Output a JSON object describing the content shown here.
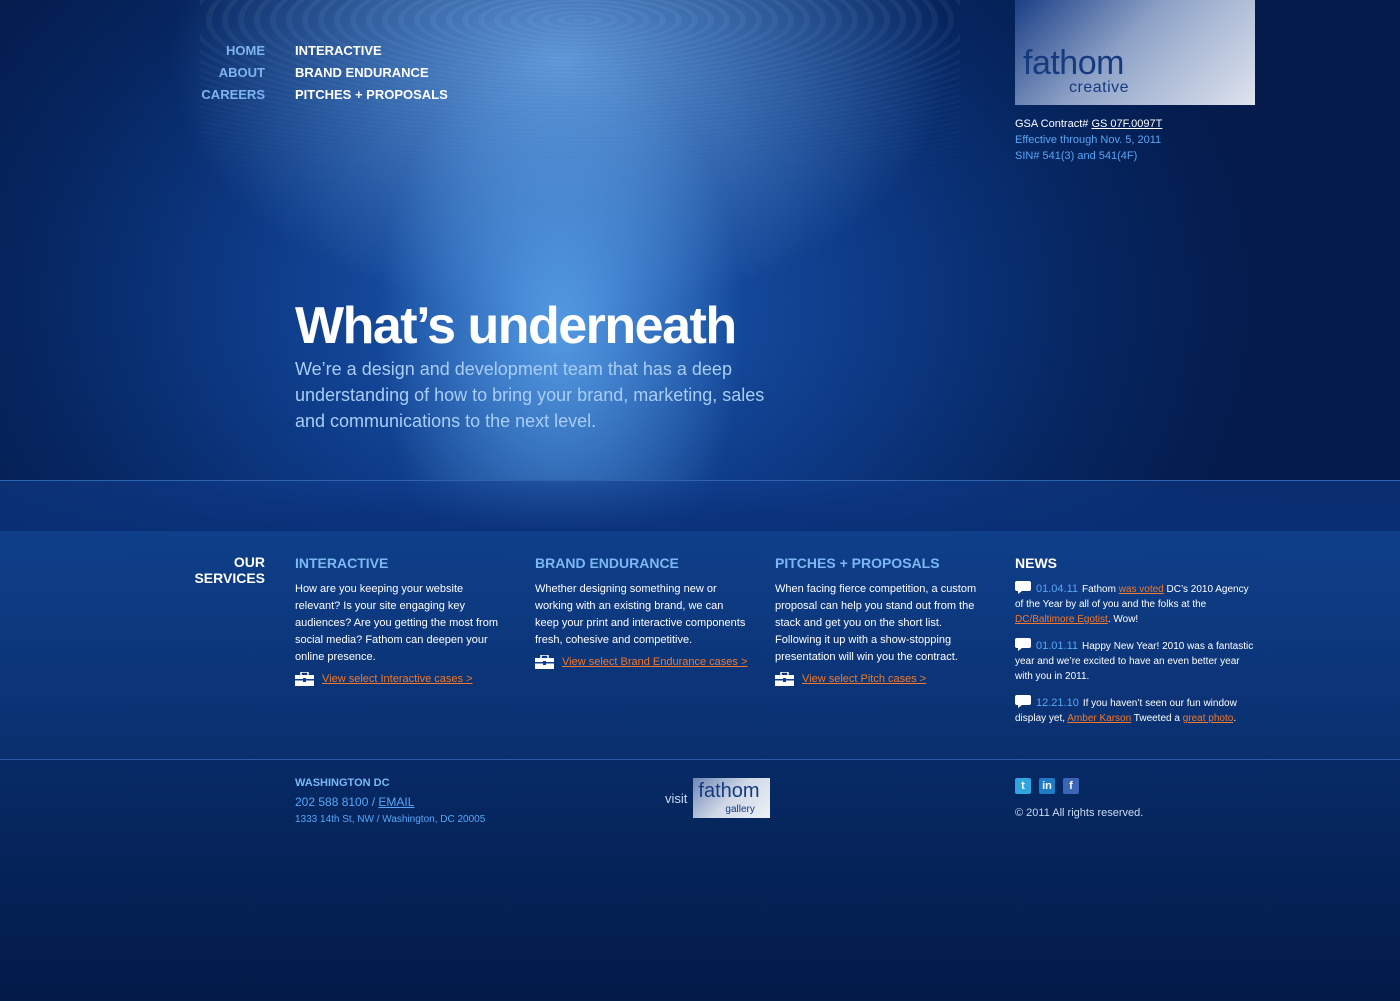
{
  "nav": {
    "left": [
      "HOME",
      "ABOUT",
      "CAREERS"
    ],
    "right": [
      "INTERACTIVE",
      "BRAND ENDURANCE",
      "PITCHES + PROPOSALS"
    ]
  },
  "logo": {
    "word": "fathom",
    "sub": "creative"
  },
  "gsa": {
    "label": "GSA Contract#",
    "number": "GS 07F.0097T",
    "effective": "Effective through Nov. 5, 2011",
    "sin": "SIN# 541(3) and 541(4F)"
  },
  "hero": {
    "headline": "What’s underneath",
    "intro": "We’re a design and development team that has a deep understanding of how to bring your brand, marketing, sales and communications to the next level."
  },
  "services": {
    "heading": "OUR SERVICES",
    "items": [
      {
        "title": "INTERACTIVE",
        "text": "How are you keeping your website relevant? Is your site engaging key audiences? Are you getting the most from social media? Fathom can deepen your online presence.",
        "link": "View select Interactive cases >"
      },
      {
        "title": "BRAND ENDURANCE",
        "text": "Whether designing something new or working with an existing brand, we can keep your print and interactive components fresh, cohesive and competitive.",
        "link": "View select Brand Endurance cases >"
      },
      {
        "title": "PITCHES + PROPOSALS",
        "text": "When facing fierce competition, a custom proposal can help you stand out from the stack and get you on the short list. Following it up with a show-stopping presentation will win you the contract.",
        "link": "View select Pitch cases >"
      }
    ]
  },
  "news": {
    "heading": "NEWS",
    "items": [
      {
        "date": "01.04.11",
        "t1": "Fathom ",
        "l1": "was voted",
        "t2": " DC’s 2010 Agency of the Year by all of you and the folks at the ",
        "l2": "DC/Baltimore Egotist",
        "t3": ". Wow!"
      },
      {
        "date": "01.01.11",
        "text": "Happy New Year! 2010 was a fantastic year and we’re excited to have an even better year with you in 2011."
      },
      {
        "date": "12.21.10",
        "t1": "If you haven’t seen our fun window display yet, ",
        "l1": "Amber Karson",
        "t2": " Tweeted a ",
        "l2": "great photo",
        "t3": "."
      }
    ]
  },
  "footer": {
    "city": "WASHINGTON DC",
    "phone": "202 588 8100 / ",
    "email": "EMAIL",
    "address": "1333 14th St, NW / Washington, DC 20005",
    "visit": "visit",
    "gallery_word": "fathom",
    "gallery_sub": "gallery",
    "copyright": "© 2011 All rights reserved."
  },
  "social": {
    "twitter": "t",
    "linkedin": "in",
    "facebook": "f",
    "colors": {
      "twitter": "#2fa6e0",
      "linkedin": "#1f7bc4",
      "facebook": "#3b66b8"
    }
  },
  "colors": {
    "accent_orange": "#f2782b",
    "accent_blue": "#58a6f5"
  }
}
